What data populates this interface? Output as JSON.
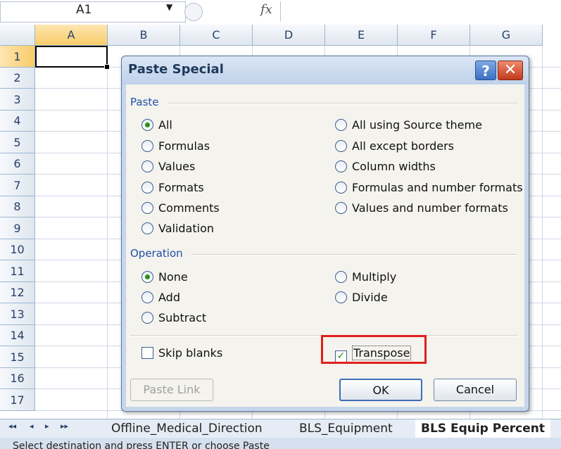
{
  "formula_bar": {
    "name_box": "A1",
    "fx_label": "fx"
  },
  "columns": [
    "A",
    "B",
    "C",
    "D",
    "E",
    "F",
    "G"
  ],
  "rows": [
    "1",
    "2",
    "3",
    "4",
    "5",
    "6",
    "7",
    "8",
    "9",
    "10",
    "11",
    "12",
    "13",
    "14",
    "15",
    "16",
    "17"
  ],
  "sheet_tabs": {
    "nav": [
      "◂◂",
      "◂",
      "▸",
      "▸▸"
    ],
    "tabs": [
      "Offline_Medical_Direction",
      "BLS_Equipment",
      "BLS Equip Percent"
    ],
    "active_tab": "BLS Equip Percent"
  },
  "status_bar": {
    "text": "Select destination and press ENTER or choose Paste"
  },
  "dialog": {
    "title": "Paste Special",
    "help_label": "?",
    "close_label": "✕",
    "paste_group": {
      "label": "Paste",
      "left_options": [
        "All",
        "Formulas",
        "Values",
        "Formats",
        "Comments",
        "Validation"
      ],
      "right_options": [
        "All using Source theme",
        "All except borders",
        "Column widths",
        "Formulas and number formats",
        "Values and number formats"
      ],
      "selected": "All"
    },
    "operation_group": {
      "label": "Operation",
      "left_options": [
        "None",
        "Add",
        "Subtract"
      ],
      "right_options": [
        "Multiply",
        "Divide"
      ],
      "selected": "None"
    },
    "skip_blanks": {
      "label": "Skip blanks",
      "checked": false
    },
    "transpose": {
      "label": "Transpose",
      "checked": true
    },
    "paste_link_label": "Paste Link",
    "ok_label": "OK",
    "cancel_label": "Cancel"
  }
}
